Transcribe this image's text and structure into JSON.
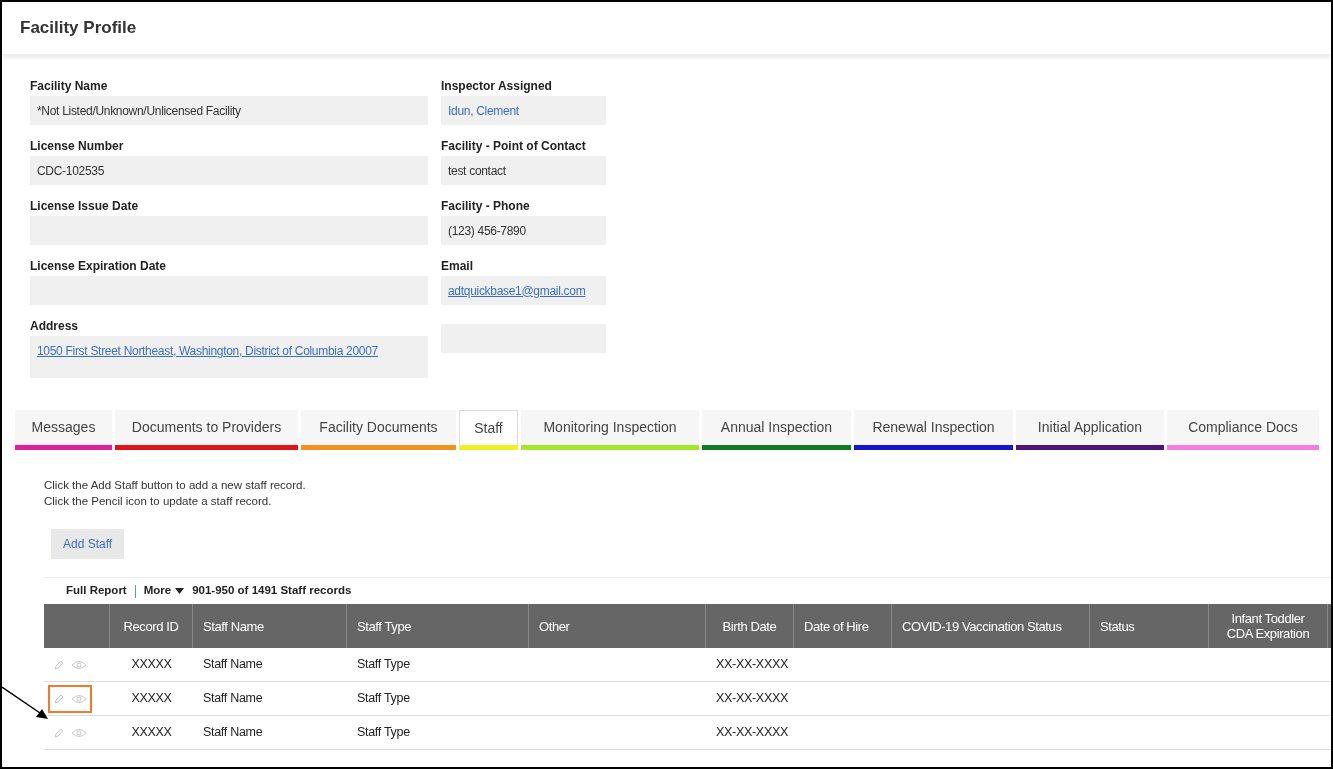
{
  "page": {
    "title": "Facility Profile"
  },
  "fields_left": [
    {
      "label": "Facility Name",
      "kind": "text",
      "value": "*Not Listed/Unknown/Unlicensed Facility"
    },
    {
      "label": "License Number",
      "kind": "text",
      "value": "CDC-102535"
    },
    {
      "label": "License Issue Date",
      "kind": "text"
    },
    {
      "label": "License Expiration Date",
      "kind": "text"
    },
    {
      "label": "Address",
      "kind": "address",
      "value": "1050 First Street Northeast, Washington, District of Columbia 20007"
    }
  ],
  "fields_right": [
    {
      "label": "Inspector Assigned",
      "kind": "name",
      "value": "Idun, Clement"
    },
    {
      "label": "Facility - Point of Contact",
      "kind": "text",
      "value": "test contact"
    },
    {
      "label": "Facility - Phone",
      "kind": "text",
      "value": "(123) 456-7890"
    },
    {
      "label": "Email",
      "kind": "link",
      "value": "adtquickbase1@gmail.com"
    },
    {
      "kind": "blank"
    }
  ],
  "tabs": [
    {
      "label": "Messages",
      "selected": false,
      "color": "#e0209a"
    },
    {
      "label": "Documents to Providers",
      "selected": false,
      "color": "#e01414"
    },
    {
      "label": "Facility Documents",
      "selected": false,
      "color": "#f0921c"
    },
    {
      "label": "Staff",
      "selected": true,
      "color": "#eef020"
    },
    {
      "label": "Monitoring Inspection",
      "selected": false,
      "color": "#a4e628"
    },
    {
      "label": "Annual Inspection",
      "selected": false,
      "color": "#127a24"
    },
    {
      "label": "Renewal Inspection",
      "selected": false,
      "color": "#1414d4"
    },
    {
      "label": "Initial Application",
      "selected": false,
      "color": "#4e1478"
    },
    {
      "label": "Compliance Docs",
      "selected": false,
      "color": "#f07ee4"
    }
  ],
  "instructions": [
    "Click the Add Staff button to add a new staff record.",
    "Click the Pencil icon to update a staff record."
  ],
  "add_button": "Add Staff",
  "report": {
    "full_report": "Full Report",
    "more": "More",
    "count": "901-950 of 1491 Staff records"
  },
  "table": {
    "columns": [
      "Record ID",
      "Staff Name",
      "Staff Type",
      "Other",
      "Birth Date",
      "Date of Hire",
      "COVID-19 Vaccination Status",
      "Status",
      "Infant Toddler CDA Expiration"
    ],
    "rows": [
      {
        "highlighted": false,
        "cells": [
          "XXXXX",
          "Staff Name",
          "Staff Type",
          "",
          "XX-XX-XXXX",
          "",
          "",
          "",
          ""
        ]
      },
      {
        "highlighted": true,
        "cells": [
          "XXXXX",
          "Staff Name",
          "Staff Type",
          "",
          "XX-XX-XXXX",
          "",
          "",
          "",
          ""
        ]
      },
      {
        "highlighted": false,
        "cells": [
          "XXXXX",
          "Staff Name",
          "Staff Type",
          "",
          "XX-XX-XXXX",
          "",
          "",
          "",
          ""
        ]
      }
    ]
  }
}
